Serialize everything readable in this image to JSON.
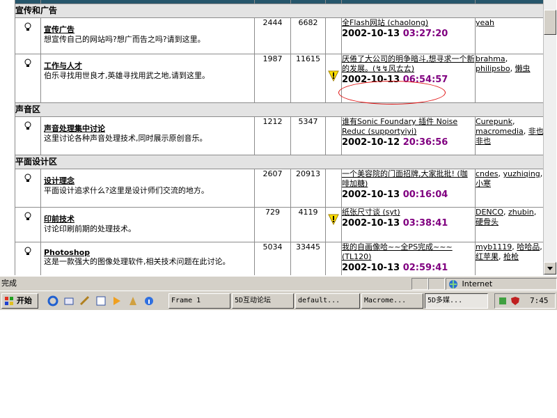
{
  "forum": {
    "sections": [
      {
        "title": "宣传和广告",
        "forums": [
          {
            "name": "宣传广告",
            "desc": "想宣传自己的网站吗?想广而告之吗?请到这里。",
            "topics": "2444",
            "posts": "6682",
            "new_flag": false,
            "last_title": "全Flash网站 (chaolong)",
            "last_date": "2002-10-13 ",
            "last_time": "03:27:20",
            "mods": [
              "yeah"
            ]
          },
          {
            "name": "工作与人才",
            "desc": "伯乐寻找用世良才,英雄寻找用武之地,请到这里。",
            "topics": "1987",
            "posts": "11615",
            "new_flag": true,
            "last_title": "厌倦了大公司的明争暗斗,想寻求一个新的发展。(↯↯风ㄊㄊ)",
            "last_date": "2002-10-13 ",
            "last_time": "06:54:57",
            "mods": [
              "brahma",
              "philipsbo",
              "懒虫"
            ]
          }
        ]
      },
      {
        "title": "声音区",
        "forums": [
          {
            "name": "声音处理集中讨论",
            "desc": "这里讨论各种声音处理技术,同时展示原创音乐。",
            "topics": "1212",
            "posts": "5347",
            "new_flag": false,
            "last_title": "谁有Sonic Foundary 插件 Noise Reduc (supportyiyi)",
            "last_date": "2002-10-12 ",
            "last_time": "20:36:56",
            "mods": [
              "Curepunk",
              "macromedia",
              "非也非也"
            ]
          }
        ]
      },
      {
        "title": "平面设计区",
        "forums": [
          {
            "name": "设计理念",
            "desc": "平面设计追求什么?这里是设计师们交流的地方。",
            "topics": "2607",
            "posts": "20913",
            "new_flag": false,
            "last_title": "一个美容院的门面招牌,大家批批! (咖啡加糖)",
            "last_date": "2002-10-13 ",
            "last_time": "00:16:04",
            "mods": [
              "cndes",
              "yuzhiqing",
              "小寒"
            ]
          },
          {
            "name": "印前技术",
            "desc": "讨论印刷前期的处理技术。",
            "topics": "729",
            "posts": "4119",
            "new_flag": true,
            "last_title": "纸张尺寸谈 (syt)",
            "last_date": "2002-10-13 ",
            "last_time": "03:38:41",
            "mods": [
              "DENCO",
              "zhubin",
              "硬骨头"
            ]
          },
          {
            "name": "Photoshop",
            "desc": "这是一款强大的图像处理软件,相关技术问题在此讨论。",
            "topics": "5034",
            "posts": "33445",
            "new_flag": false,
            "last_title": "我的自画像哈~~全PS完成~~~ (TL120)",
            "last_date": "2002-10-13 ",
            "last_time": "02:59:41",
            "mods": [
              "myb1119",
              "哈哈品",
              "红苹果",
              "枪枪"
            ]
          }
        ]
      }
    ]
  },
  "statusbar": {
    "status": "完成",
    "zone": "Internet"
  },
  "taskbar": {
    "start": "开始",
    "tasks": [
      "Frame 1",
      "5D互动论坛",
      "default...",
      "Macrome...",
      "5D多媒..."
    ],
    "clock": "7:45"
  },
  "colors": {
    "time": "#800080",
    "highlight_circle": "#e01010",
    "header_strip": "#26566b",
    "section_bg": "#e3e3e3"
  }
}
